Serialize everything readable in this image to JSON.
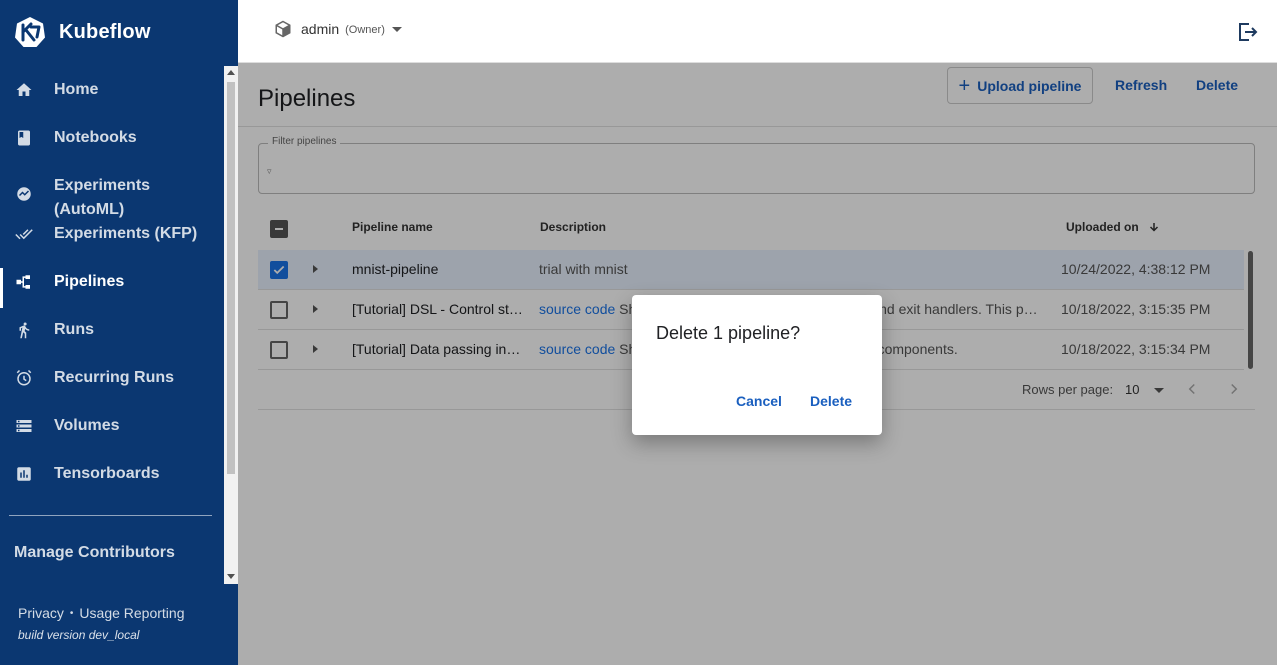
{
  "brand": {
    "name": "Kubeflow"
  },
  "sidebar": {
    "items": [
      {
        "label": "Home",
        "icon": "home-icon"
      },
      {
        "label": "Notebooks",
        "icon": "notebook-icon"
      },
      {
        "label": "Experiments\n(AutoML)",
        "label_line1": "Experiments",
        "label_line2": "(AutoML)",
        "icon": "automl-icon"
      },
      {
        "label": "Experiments (KFP)",
        "icon": "done-all-icon"
      },
      {
        "label": "Pipelines",
        "icon": "pipelines-icon",
        "active": true
      },
      {
        "label": "Runs",
        "icon": "runs-icon"
      },
      {
        "label": "Recurring Runs",
        "icon": "alarm-icon"
      },
      {
        "label": "Volumes",
        "icon": "storage-icon"
      },
      {
        "label": "Tensorboards",
        "icon": "assessment-icon"
      }
    ],
    "manage_contributors": "Manage Contributors",
    "footer": {
      "privacy": "Privacy",
      "separator": "•",
      "usage": "Usage Reporting",
      "build": "build version dev_local"
    }
  },
  "topbar": {
    "namespace": "admin",
    "role": "(Owner)"
  },
  "page": {
    "title": "Pipelines",
    "upload_label": "Upload pipeline",
    "refresh_label": "Refresh",
    "delete_label": "Delete",
    "filter_label": "Filter pipelines",
    "filter_icon": "▿"
  },
  "table": {
    "columns": {
      "name": "Pipeline name",
      "description": "Description",
      "uploaded": "Uploaded on"
    },
    "rows": [
      {
        "name": "mnist-pipeline",
        "desc_link": "",
        "desc_text": "trial with mnist",
        "date": "10/24/2022, 4:38:12 PM",
        "selected": true
      },
      {
        "name": "[Tutorial] DSL - Control structures",
        "desc_link": "source code",
        "desc_text": " Shows how to use conditional execution and exit handlers. This pipeline will randomly fail to demonstrate that the exit handler gets executed even in case of failure.",
        "date": "10/18/2022, 3:15:35 PM",
        "selected": false
      },
      {
        "name": "[Tutorial] Data passing in python components",
        "desc_link": "source code",
        "desc_text": " Shows how to pass data between python components.",
        "date": "10/18/2022, 3:15:34 PM",
        "selected": false
      }
    ]
  },
  "pagination": {
    "label": "Rows per page:",
    "value": "10"
  },
  "dialog": {
    "title": "Delete 1 pipeline?",
    "cancel": "Cancel",
    "confirm": "Delete"
  },
  "colors": {
    "sidebar": "#0b3771",
    "accent": "#1a73e8",
    "link": "#1a5fbf"
  }
}
